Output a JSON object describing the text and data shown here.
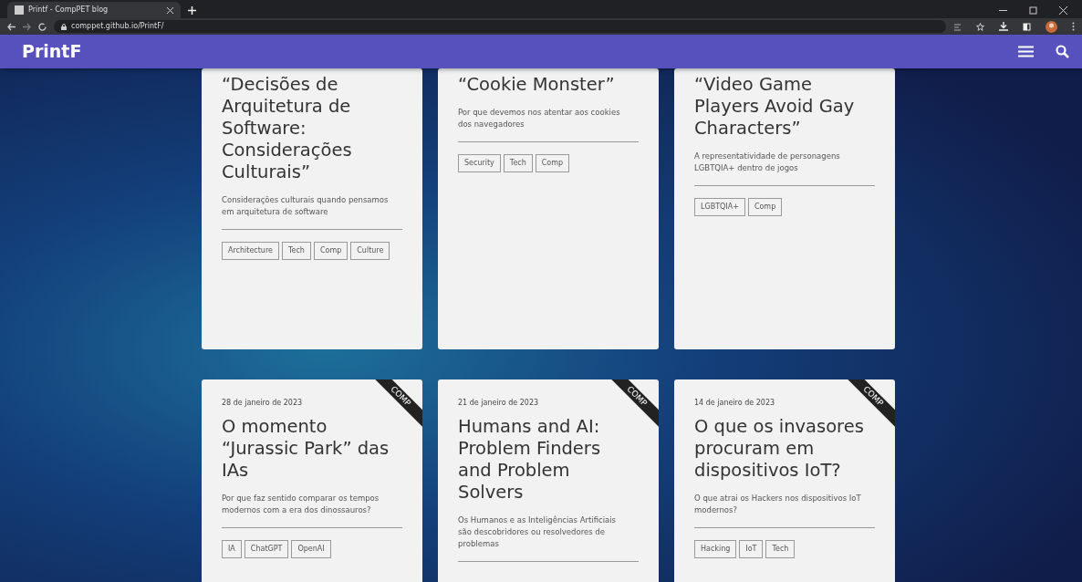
{
  "browser": {
    "tab_title": "Printf - CompPET blog",
    "url": "comppet.github.io/PrintF/"
  },
  "navbar": {
    "brand": "PrintF"
  },
  "posts": [
    {
      "title": "“Decisões de Arquitetura de Software: Considerações Culturais”",
      "summary": "Considerações culturais quando pensamos em arquitetura de software",
      "tags": [
        "Architecture",
        "Tech",
        "Comp",
        "Culture"
      ]
    },
    {
      "title": "“Cookie Monster”",
      "summary": "Por que devemos nos atentar aos cookies dos navegadores",
      "tags": [
        "Security",
        "Tech",
        "Comp"
      ]
    },
    {
      "title": "“Video Game Players Avoid Gay Characters”",
      "summary": "A representatividade de personagens LGBTQIA+ dentro de jogos",
      "tags": [
        "LGBTQIA+",
        "Comp"
      ]
    },
    {
      "ribbon": "COMP",
      "date": "28 de janeiro de 2023",
      "title": "O momento “Jurassic Park” das IAs",
      "summary": "Por que faz sentido comparar os tempos modernos com a era dos dinossauros?",
      "tags": [
        "IA",
        "ChatGPT",
        "OpenAI"
      ]
    },
    {
      "ribbon": "COMP",
      "date": "21 de janeiro de 2023",
      "title": "Humans and AI: Problem Finders and Problem Solvers",
      "summary": "Os Humanos e as Inteligências Artificiais são descobridores ou resolvedores de problemas"
    },
    {
      "ribbon": "COMP",
      "date": "14 de janeiro de 2023",
      "title": "O que os invasores procuram em dispositivos IoT?",
      "summary": "O que atrai os Hackers nos dispositivos IoT modernos?",
      "tags": [
        "Hacking",
        "IoT",
        "Tech"
      ]
    }
  ]
}
